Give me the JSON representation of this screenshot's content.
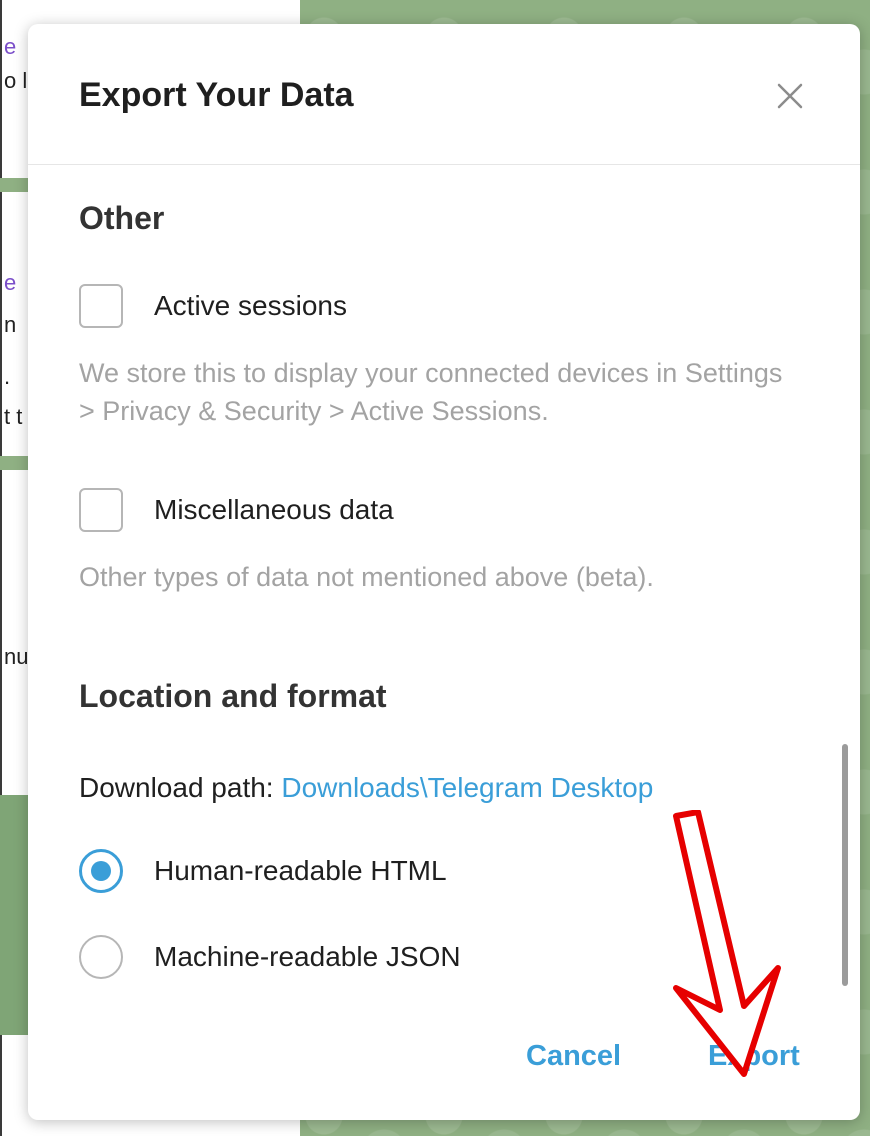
{
  "dialog": {
    "title": "Export Your Data",
    "close_icon": "close-icon"
  },
  "other_section": {
    "title": "Other",
    "items": [
      {
        "label": "Active sessions",
        "checked": false,
        "description": "We store this to display your connected devices in Settings > Privacy & Security > Active Sessions."
      },
      {
        "label": "Miscellaneous data",
        "checked": false,
        "description": "Other types of data not mentioned above (beta)."
      }
    ]
  },
  "location_section": {
    "title": "Location and format",
    "path_label": "Download path:",
    "path_value": "Downloads\\Telegram Desktop",
    "formats": [
      {
        "label": "Human-readable HTML",
        "selected": true
      },
      {
        "label": "Machine-readable JSON",
        "selected": false
      }
    ]
  },
  "actions": {
    "cancel_label": "Cancel",
    "export_label": "Export"
  },
  "background": {
    "fragments": [
      "e",
      "o l",
      "e",
      "n",
      ".",
      "t t",
      "nu"
    ]
  },
  "colors": {
    "accent": "#3a9ed8",
    "arrow": "#e60000",
    "chat_bg": "#8fb083"
  }
}
